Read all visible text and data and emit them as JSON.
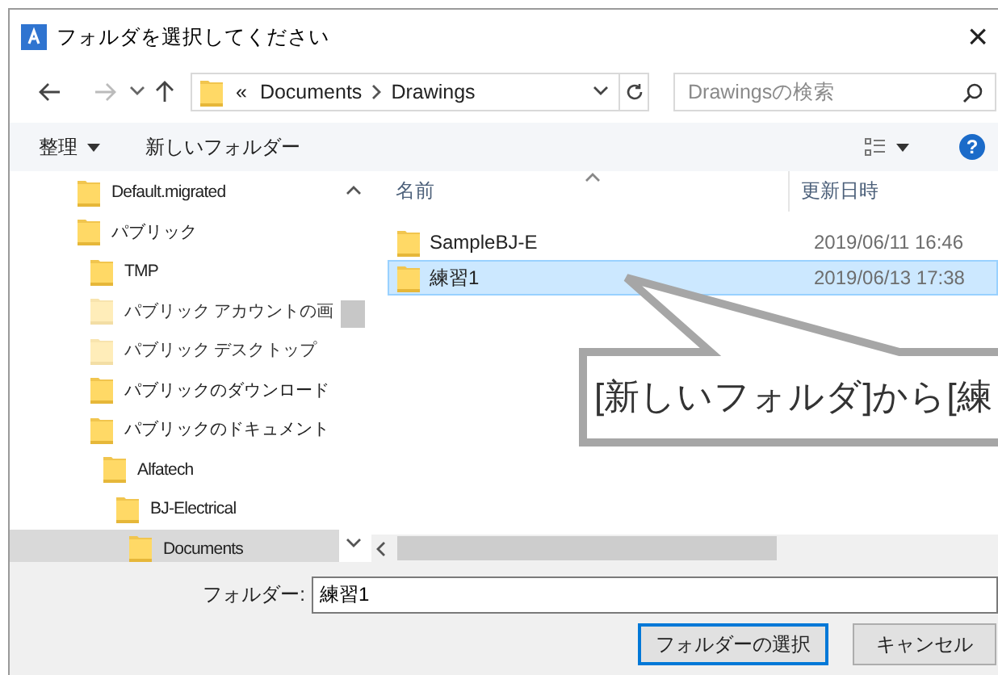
{
  "window": {
    "title": "フォルダを選択してください",
    "close": "×"
  },
  "nav": {
    "overflow": "«",
    "path": [
      "Documents",
      "Drawings"
    ],
    "search": {
      "placeholder": "Drawingsの検索"
    }
  },
  "toolbar": {
    "organize": "整理",
    "new_folder": "新しいフォルダー",
    "help": "?"
  },
  "tree": [
    {
      "label": "Default.migrated",
      "hidden": false,
      "selected": false
    },
    {
      "label": "パブリック",
      "hidden": false,
      "selected": false,
      "children": [
        {
          "label": "TMP",
          "hidden": false,
          "selected": false
        },
        {
          "label": "パブリック アカウントの画",
          "hidden": true,
          "selected": false
        },
        {
          "label": "パブリック デスクトップ",
          "hidden": true,
          "selected": false
        },
        {
          "label": "パブリックのダウンロード",
          "hidden": false,
          "selected": false
        },
        {
          "label": "パブリックのドキュメント",
          "hidden": false,
          "selected": false,
          "children": [
            {
              "label": "Alfatech",
              "hidden": false,
              "selected": false,
              "children": [
                {
                  "label": "BJ-Electrical",
                  "hidden": false,
                  "selected": false,
                  "children": [
                    {
                      "label": "Documents",
                      "hidden": false,
                      "selected": true
                    }
                  ]
                }
              ]
            }
          ]
        }
      ]
    }
  ],
  "list": {
    "columns": [
      "名前",
      "更新日時"
    ],
    "rows": [
      {
        "name": "SampleBJ-E",
        "modified": "2019/06/11 16:46",
        "selected": false
      },
      {
        "name": "練習1",
        "modified": "2019/06/13 17:38",
        "selected": true
      }
    ]
  },
  "folder_field": {
    "label": "フォルダー:",
    "value": "練習1"
  },
  "buttons": [
    {
      "label": "フォルダーの選択",
      "default": true
    },
    {
      "label": "キャンセル",
      "default": false
    }
  ],
  "callout": {
    "text": "[新しいフォルダ]から[練"
  }
}
